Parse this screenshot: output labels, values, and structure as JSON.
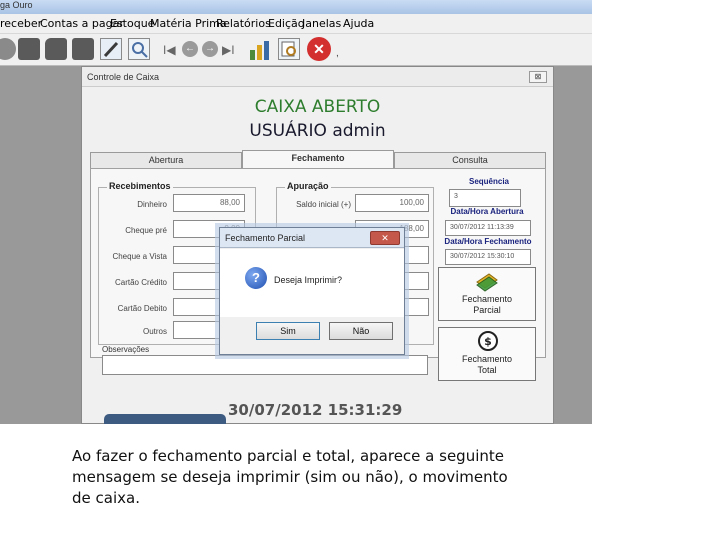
{
  "app": {
    "title": "ga Ouro"
  },
  "menu": [
    "receber",
    "Contas a pagar",
    "Estoque",
    "Matéria Prima",
    "Relatórios",
    "Edição",
    "Janelas",
    "Ajuda"
  ],
  "toolbar": {
    "icons": [
      "printer-icon",
      "document-icon",
      "document-icon",
      "document-icon",
      "edit-icon",
      "search-icon",
      "nav-first-icon",
      "nav-prev-icon",
      "nav-next-icon",
      "nav-last-icon",
      "chart-icon",
      "preview-icon",
      "close-icon"
    ],
    "nav_first": "I◀",
    "nav_prev": "←",
    "nav_next": "→",
    "nav_last": "▶I",
    "close_glyph": "✕",
    "trailing_mark": ","
  },
  "window": {
    "title": "Controle de Caixa",
    "close_glyph": "⊠",
    "status": "CAIXA ABERTO",
    "user": "USUÁRIO admin",
    "tabs": [
      "Abertura",
      "Fechamento",
      "Consulta"
    ],
    "active_tab": "Fechamento",
    "recebimentos": {
      "title": "Recebimentos",
      "fields": [
        {
          "label": "Dinheiro",
          "value": "88,00"
        },
        {
          "label": "Cheque pré",
          "value": "0,00"
        },
        {
          "label": "Cheque a Vista",
          "value": ""
        },
        {
          "label": "Cartão Crédito",
          "value": ""
        },
        {
          "label": "Cartão Debito",
          "value": ""
        },
        {
          "label": "Outros",
          "value": ""
        }
      ]
    },
    "apuracao": {
      "title": "Apuração",
      "fields": [
        {
          "label": "Saldo inicial (+)",
          "value": "100,00"
        },
        {
          "label": "",
          "value": "188,00"
        },
        {
          "label": "",
          "value": ""
        },
        {
          "label": "",
          "value": ""
        },
        {
          "label": "",
          "value": ""
        }
      ]
    },
    "sequencia": {
      "label": "Sequência",
      "value": "3"
    },
    "abertura": {
      "label": "Data/Hora Abertura",
      "value": "30/07/2012 11:13:39"
    },
    "fechamento": {
      "label": "Data/Hora Fechamento",
      "value": "30/07/2012 15:30:10"
    },
    "btn_parcial": {
      "line1": "Fechamento",
      "line2": "Parcial"
    },
    "btn_total": {
      "line1": "Fechamento",
      "line2": "Total"
    },
    "observacoes": {
      "label": "Observações",
      "value": ""
    },
    "datetime": "30/07/2012 15:31:29"
  },
  "dialog": {
    "title": "Fechamento Parcial",
    "close_glyph": "✕",
    "icon_glyph": "?",
    "message": "Deseja Imprimir?",
    "yes": "Sim",
    "no": "Não"
  },
  "caption": "Ao fazer o fechamento parcial e total, aparece a seguinte mensagem se deseja imprimir (sim ou não), o movimento de caixa."
}
